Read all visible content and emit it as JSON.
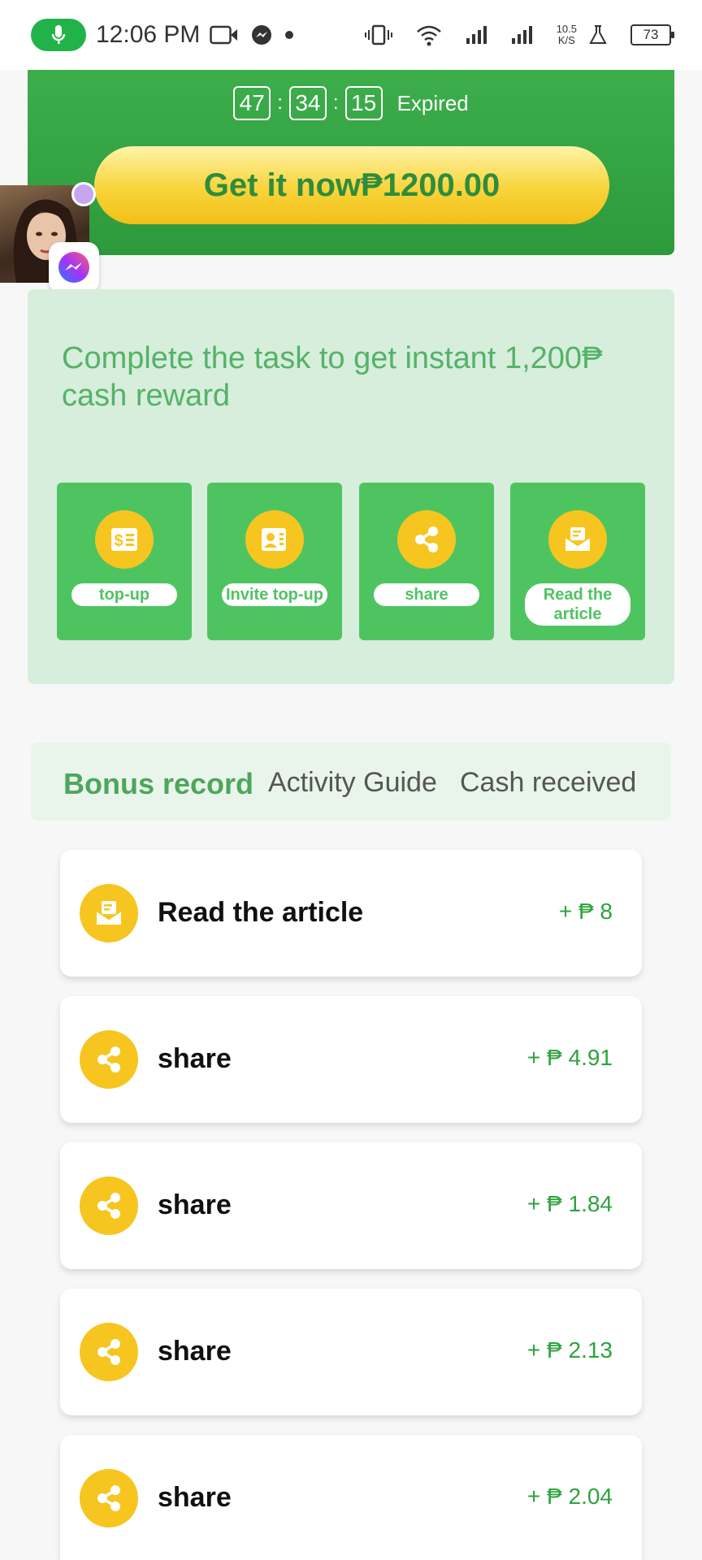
{
  "status_bar": {
    "time": "12:06 PM",
    "net_speed_value": "10.5",
    "net_speed_unit": "K/S",
    "battery": "73"
  },
  "banner": {
    "countdown": {
      "hours": "47",
      "minutes": "34",
      "seconds": "15",
      "separator": ":",
      "expired_label": "Expired"
    },
    "cta_label": "Get it now₱1200.00"
  },
  "task_panel": {
    "title": "Complete the task to get instant 1,200₱ cash reward",
    "tasks": [
      {
        "label": "top-up",
        "icon": "dollar-receipt-icon"
      },
      {
        "label": "Invite top-up",
        "icon": "contact-card-icon"
      },
      {
        "label": "share",
        "icon": "share-icon"
      },
      {
        "label": "Read the article",
        "icon": "envelope-icon"
      }
    ]
  },
  "tabs": [
    {
      "label": "Bonus record",
      "active": true
    },
    {
      "label": "Activity Guide",
      "active": false
    },
    {
      "label": "Cash received",
      "active": false
    }
  ],
  "records": [
    {
      "title": "Read the article",
      "amount": "+ ₱ 8",
      "icon": "envelope-icon"
    },
    {
      "title": "share",
      "amount": "+ ₱ 4.91",
      "icon": "share-icon"
    },
    {
      "title": "share",
      "amount": "+ ₱ 1.84",
      "icon": "share-icon"
    },
    {
      "title": "share",
      "amount": "+ ₱ 2.13",
      "icon": "share-icon"
    },
    {
      "title": "share",
      "amount": "+ ₱ 2.04",
      "icon": "share-icon"
    }
  ],
  "colors": {
    "brand_green": "#3dae4b",
    "task_green": "#4ec461",
    "panel_green": "#d6eedb",
    "accent_yellow": "#f7c51f",
    "amount_green": "#2ea33e"
  }
}
